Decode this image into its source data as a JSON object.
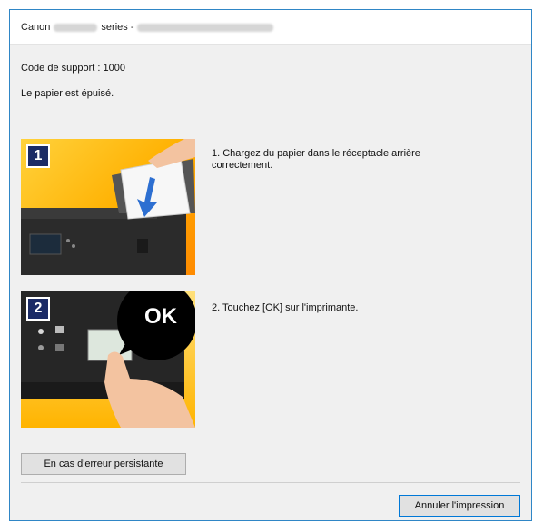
{
  "window": {
    "title_prefix": "Canon",
    "title_model_redacted": "",
    "title_series": "series -",
    "title_port_redacted": ""
  },
  "dialog": {
    "support_code": "Code de support : 1000",
    "message": "Le papier est épuisé."
  },
  "steps": [
    {
      "badge": "1",
      "text": "1.  Chargez du papier dans le réceptacle arrière correctement."
    },
    {
      "badge": "2",
      "text": "2.  Touchez [OK] sur l'imprimante."
    }
  ],
  "illustration2": {
    "ok_label": "OK"
  },
  "buttons": {
    "persistent_error": "En cas d'erreur persistante",
    "cancel_printing": "Annuler l'impression"
  },
  "colors": {
    "window_border": "#2f86c6",
    "badge_bg": "#1b2b66",
    "accent": "#0078d7"
  }
}
